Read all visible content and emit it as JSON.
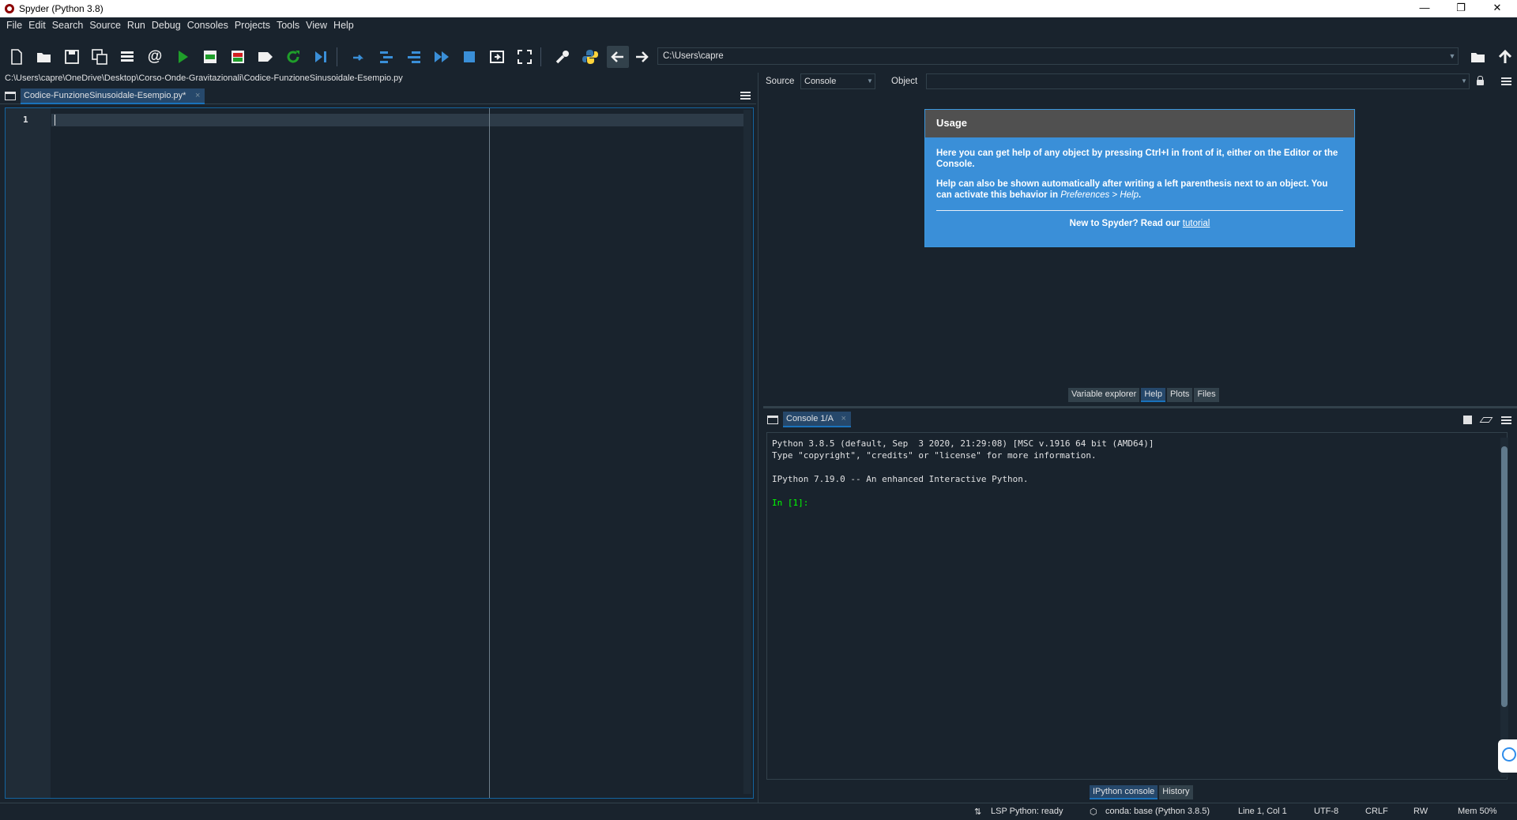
{
  "window": {
    "title": "Spyder (Python 3.8)"
  },
  "menu": [
    "File",
    "Edit",
    "Search",
    "Source",
    "Run",
    "Debug",
    "Consoles",
    "Projects",
    "Tools",
    "View",
    "Help"
  ],
  "toolbar": {
    "working_dir": "C:\\Users\\capre"
  },
  "editor": {
    "file_path": "C:\\Users\\capre\\OneDrive\\Desktop\\Corso-Onde-Gravitazionali\\Codice-FunzioneSinusoidale-Esempio.py",
    "tab_label": "Codice-FunzioneSinusoidale-Esempio.py*",
    "line_numbers": [
      "1"
    ]
  },
  "help": {
    "source_label": "Source",
    "source_value": "Console",
    "object_label": "Object",
    "usage_title": "Usage",
    "usage_p1_a": "Here you can get help of any object by pressing Ctrl+I in front of it, either on the Editor or the Console.",
    "usage_p2_a": "Help can also be shown automatically after writing a left parenthesis next to an object. You can activate this behavior in ",
    "usage_p2_em": "Preferences > Help",
    "usage_p2_b": ".",
    "usage_foot": "New to Spyder? Read our ",
    "usage_link": "tutorial"
  },
  "pane_tabs_top": [
    "Variable explorer",
    "Help",
    "Plots",
    "Files"
  ],
  "console": {
    "tab_label": "Console 1/A",
    "lines": [
      "Python 3.8.5 (default, Sep  3 2020, 21:29:08) [MSC v.1916 64 bit (AMD64)]",
      "Type \"copyright\", \"credits\" or \"license\" for more information.",
      "",
      "IPython 7.19.0 -- An enhanced Interactive Python."
    ],
    "prompt": "In [1]:"
  },
  "pane_tabs_bottom": [
    "IPython console",
    "History"
  ],
  "status": {
    "lsp": "LSP Python: ready",
    "conda": "conda: base (Python 3.8.5)",
    "position": "Line 1, Col 1",
    "encoding": "UTF-8",
    "eol": "CRLF",
    "mode": "RW",
    "mem": "Mem 50%"
  }
}
